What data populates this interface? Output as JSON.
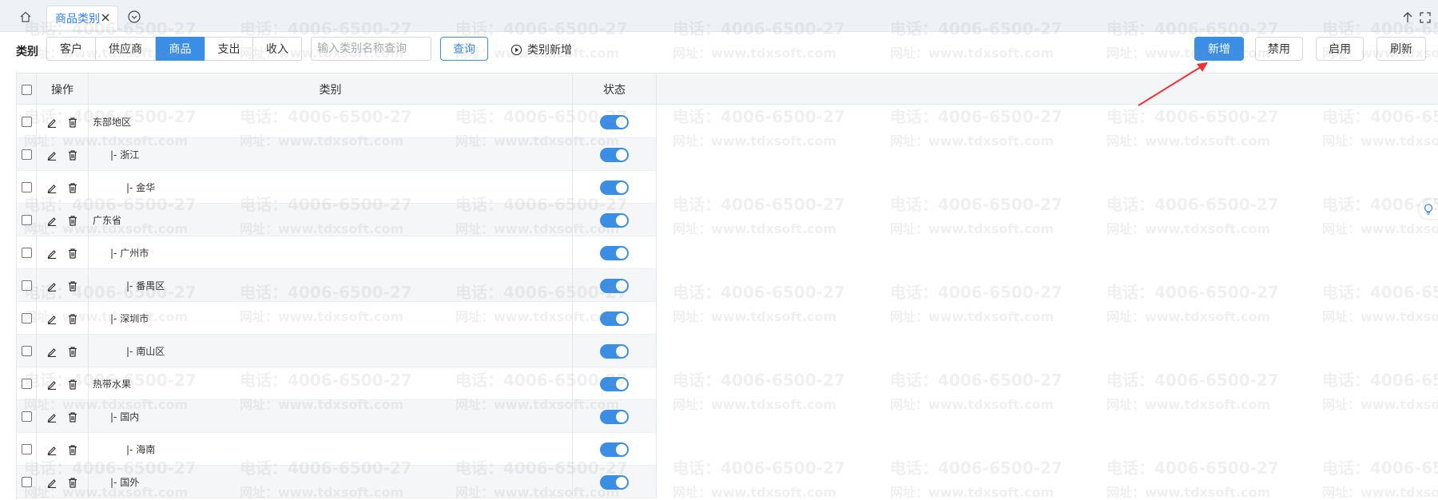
{
  "tabbar": {
    "active_tab": "商品类别"
  },
  "toolbar": {
    "category_label": "类别",
    "segments": [
      {
        "label": "客户",
        "active": false
      },
      {
        "label": "供应商",
        "active": false
      },
      {
        "label": "商品",
        "active": true
      },
      {
        "label": "支出",
        "active": false
      },
      {
        "label": "收入",
        "active": false
      }
    ],
    "search_placeholder": "输入类别名称查询",
    "query_label": "查询",
    "new_category_label": "类别新增",
    "add_label": "新增",
    "disable_label": "禁用",
    "enable_label": "启用",
    "refresh_label": "刷新"
  },
  "table": {
    "headers": {
      "action": "操作",
      "category": "类别",
      "status": "状态"
    },
    "rows": [
      {
        "name": "东部地区",
        "level": 0,
        "enabled": true
      },
      {
        "name": "|- 浙江",
        "level": 1,
        "enabled": true
      },
      {
        "name": "|- 金华",
        "level": 2,
        "enabled": true
      },
      {
        "name": "广东省",
        "level": 0,
        "enabled": true
      },
      {
        "name": "|- 广州市",
        "level": 1,
        "enabled": true
      },
      {
        "name": "|- 番禺区",
        "level": 2,
        "enabled": true
      },
      {
        "name": "|- 深圳市",
        "level": 1,
        "enabled": true
      },
      {
        "name": "|- 南山区",
        "level": 2,
        "enabled": true
      },
      {
        "name": "热带水果",
        "level": 0,
        "enabled": true
      },
      {
        "name": "|- 国内",
        "level": 1,
        "enabled": true
      },
      {
        "name": "|- 海南",
        "level": 2,
        "enabled": true
      },
      {
        "name": "|- 国外",
        "level": 1,
        "enabled": true
      }
    ]
  },
  "watermark": {
    "phone": "电话：4006-6500-27",
    "site": "网址：www.tdxsoft.com"
  },
  "colors": {
    "accent": "#3a8ee6",
    "header_bg": "#f4f5f7"
  }
}
